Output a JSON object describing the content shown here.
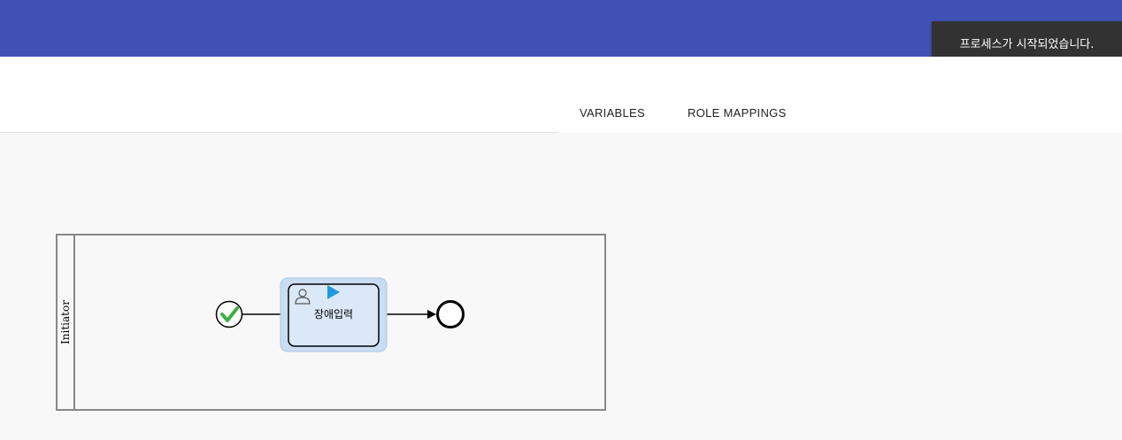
{
  "toast": {
    "message": "프로세스가 시작되었습니다."
  },
  "tabs": [
    {
      "label": "VARIABLES"
    },
    {
      "label": "ROLE MAPPINGS"
    }
  ],
  "diagram": {
    "lane": {
      "label": "Initiator"
    },
    "task": {
      "label": "장애입력",
      "state": "active"
    },
    "start_event": {
      "state": "completed"
    },
    "end_event": {
      "state": "pending"
    }
  },
  "colors": {
    "topbar": "#3f51b5",
    "toast_bg": "#323232",
    "task_highlight": "#c9dcf2",
    "task_fill": "#dbe8f8",
    "check": "#3cb043",
    "play": "#1e9be0"
  }
}
